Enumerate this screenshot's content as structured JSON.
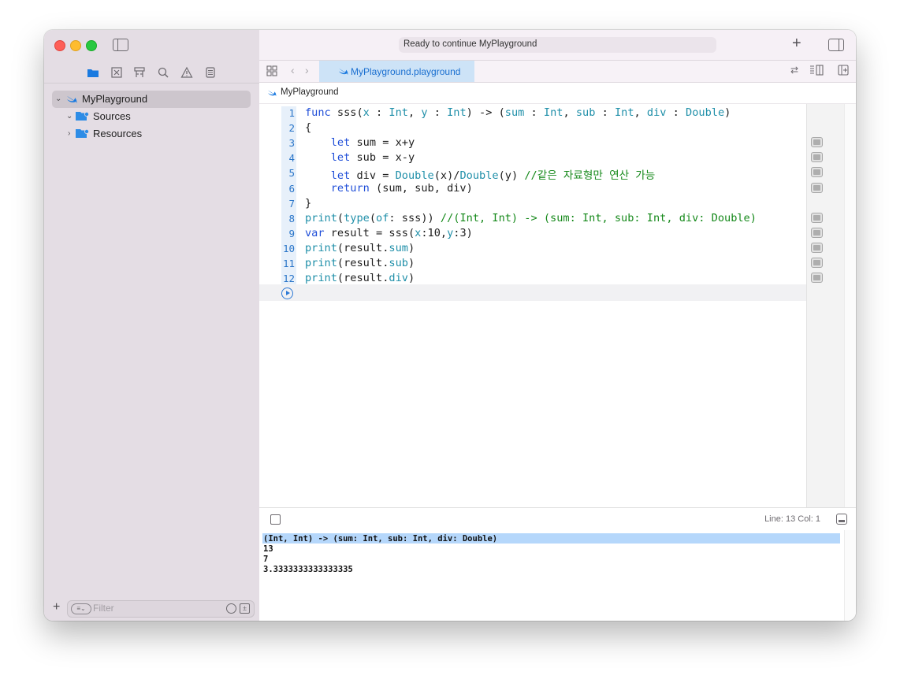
{
  "window": {
    "status": "Ready to continue MyPlayground",
    "tab_title": "MyPlayground.playground",
    "breadcrumb": "MyPlayground"
  },
  "sidebar": {
    "items": [
      {
        "label": "MyPlayground",
        "icon": "swift-icon",
        "selected": true
      },
      {
        "label": "Sources",
        "icon": "folder-icon",
        "expanded": true
      },
      {
        "label": "Resources",
        "icon": "folder-icon",
        "expanded": false
      }
    ],
    "filter_placeholder": "Filter"
  },
  "editor": {
    "line_numbers": [
      "1",
      "2",
      "3",
      "4",
      "5",
      "6",
      "7",
      "8",
      "9",
      "10",
      "11",
      "12"
    ],
    "code": [
      "func sss(x : Int, y : Int) -> (sum : Int, sub : Int, div : Double)",
      "{",
      "    let sum = x+y",
      "    let sub = x-y",
      "    let div = Double(x)/Double(y) //같은 자료형만 연산 가능",
      "    return (sum, sub, div)",
      "}",
      "print(type(of: sss)) //(Int, Int) -> (sum: Int, sub: Int, div: Double)",
      "var result = sss(x:10,y:3)",
      "print(result.sum)",
      "print(result.sub)",
      "print(result.div)"
    ]
  },
  "status_bar": {
    "position": "Line: 13  Col: 1"
  },
  "console": {
    "lines": [
      "(Int, Int) -> (sum: Int, sub: Int, div: Double)",
      "13",
      "7",
      "3.3333333333333335"
    ]
  },
  "colors": {
    "keyword": "#1f4ed8",
    "type": "#1f8fa9",
    "comment": "#15891a",
    "accent": "#1a6fd0"
  }
}
